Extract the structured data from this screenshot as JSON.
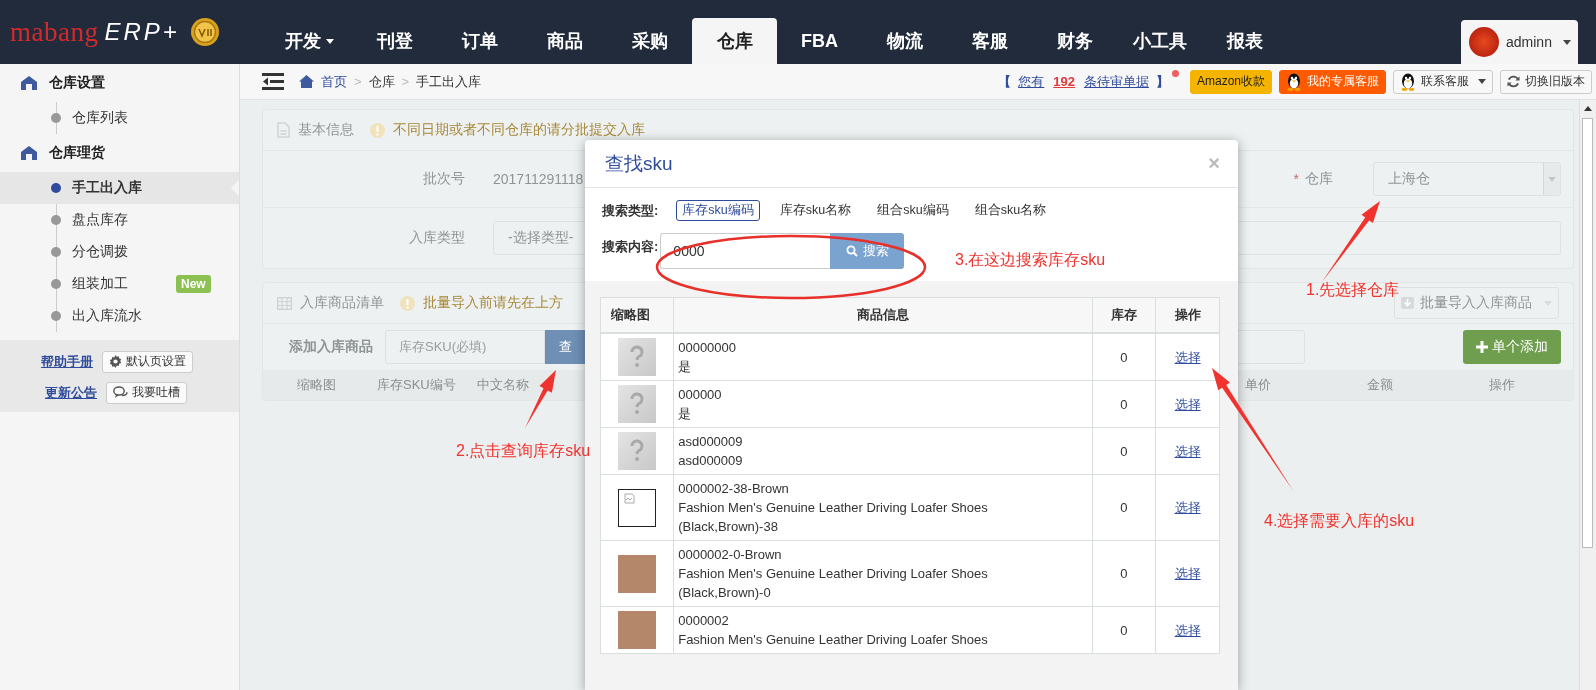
{
  "brand": {
    "name": "mabang",
    "product": "ERP+"
  },
  "nav": {
    "tabs": [
      {
        "label": "开发",
        "selected": false,
        "dropdown": true
      },
      {
        "label": "刊登",
        "selected": false,
        "dropdown": false
      },
      {
        "label": "订单",
        "selected": false,
        "dropdown": false
      },
      {
        "label": "商品",
        "selected": false,
        "dropdown": false
      },
      {
        "label": "采购",
        "selected": false,
        "dropdown": false
      },
      {
        "label": "仓库",
        "selected": true,
        "dropdown": false
      },
      {
        "label": "FBA",
        "selected": false,
        "dropdown": false
      },
      {
        "label": "物流",
        "selected": false,
        "dropdown": false
      },
      {
        "label": "客服",
        "selected": false,
        "dropdown": false
      },
      {
        "label": "财务",
        "selected": false,
        "dropdown": false
      },
      {
        "label": "小工具",
        "selected": false,
        "dropdown": false
      },
      {
        "label": "报表",
        "selected": false,
        "dropdown": false
      }
    ],
    "user": {
      "name": "adminn"
    }
  },
  "sidebar": {
    "sections": [
      {
        "title": "仓库设置",
        "items": [
          {
            "label": "仓库列表",
            "selected": false
          }
        ]
      },
      {
        "title": "仓库理货",
        "items": [
          {
            "label": "手工出入库",
            "selected": true
          },
          {
            "label": "盘点库存",
            "selected": false
          },
          {
            "label": "分仓调拨",
            "selected": false
          },
          {
            "label": "组装加工",
            "selected": false,
            "badge": "New"
          },
          {
            "label": "出入库流水",
            "selected": false
          }
        ]
      }
    ],
    "help_link": "帮助手册",
    "default_page_button": "默认页设置",
    "news_link": "更新公告",
    "feedback_button": "我要吐槽"
  },
  "breadcrumb": [
    {
      "label": "首页",
      "kind": "home"
    },
    {
      "label": "仓库",
      "kind": "plain",
      "separator": ">"
    },
    {
      "label": "手工出入库",
      "kind": "plain",
      "separator": ">"
    }
  ],
  "notice": {
    "open": "【",
    "link": "您有",
    "count": "192",
    "link_2": "条待审单据",
    "close": "】",
    "unread": true
  },
  "header_buttons": [
    {
      "label": "Amazon收款",
      "kind": "amazon"
    },
    {
      "label": "我的专属客服",
      "kind": "service"
    },
    {
      "label": "联系客服",
      "kind": "contact"
    },
    {
      "label": "切换旧版本",
      "kind": "switch"
    }
  ],
  "basic_info": {
    "title": "基本信息",
    "warning": "不同日期或者不同仓库的请分批提交入库",
    "batch_label": "批次号",
    "batch_value": "201711291118",
    "type_label": "入库类型",
    "type_placeholder": "-选择类型-",
    "required_mark": "*",
    "warehouse_label": "仓库",
    "warehouse_value": "上海仓"
  },
  "item_list": {
    "title": "入库商品清单",
    "warning": "批量导入前请先在上方",
    "import_button": "批量导入入库商品",
    "add_label": "添加入库商品",
    "sku_placeholder": "库存SKU(必填)",
    "query_button": "查",
    "add_button": "单个添加",
    "columns_left": [
      "缩略图",
      "库存SKU编号",
      "中文名称"
    ],
    "columns_right": [
      "单价",
      "金额",
      "操作"
    ]
  },
  "modal": {
    "title": "查找sku",
    "close": "×",
    "type_label": "搜索类型:",
    "types": [
      {
        "label": "库存sku编码",
        "selected": true
      },
      {
        "label": "库存sku名称",
        "selected": false
      },
      {
        "label": "组合sku编码",
        "selected": false
      },
      {
        "label": "组合sku名称",
        "selected": false
      }
    ],
    "content_label": "搜索内容:",
    "query": "0000",
    "search_button": "搜索",
    "columns": [
      "缩略图",
      "商品信息",
      "库存",
      "操作"
    ],
    "rows": [
      {
        "kind": "placeholder",
        "lines": [
          "00000000",
          "是"
        ],
        "stock": "0",
        "action": "选择"
      },
      {
        "kind": "placeholder",
        "lines": [
          "000000",
          "是"
        ],
        "stock": "0",
        "action": "选择"
      },
      {
        "kind": "placeholder",
        "lines": [
          "asd000009",
          "asd000009"
        ],
        "stock": "0",
        "action": "选择"
      },
      {
        "kind": "broken",
        "lines": [
          "0000002-38-Brown",
          "Fashion Men's Genuine Leather Driving Loafer Shoes",
          "(Black,Brown)-38"
        ],
        "stock": "0",
        "action": "选择"
      },
      {
        "kind": "photo",
        "lines": [
          "0000002-0-Brown",
          "Fashion Men's Genuine Leather Driving Loafer Shoes",
          "(Black,Brown)-0"
        ],
        "stock": "0",
        "action": "选择"
      },
      {
        "kind": "photo",
        "lines": [
          "0000002",
          "Fashion Men's Genuine Leather Driving Loafer Shoes"
        ],
        "stock": "0",
        "action": "选择"
      }
    ]
  },
  "annotations": [
    {
      "text": "1.先选择仓库",
      "kind": "arrow"
    },
    {
      "text": "2.点击查询库存sku",
      "kind": "arrow"
    },
    {
      "text": "3.在这边搜索库存sku",
      "kind": "ellipse"
    },
    {
      "text": "4.选择需要入库的sku",
      "kind": "arrow"
    }
  ]
}
